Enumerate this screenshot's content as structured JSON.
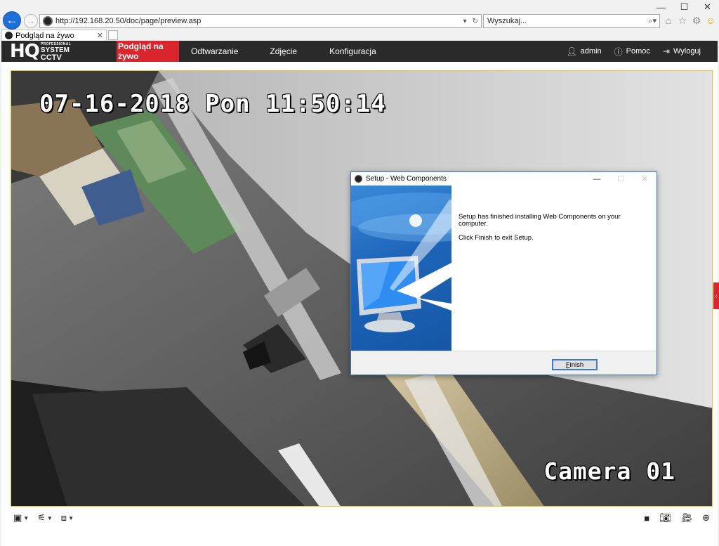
{
  "window": {
    "controls": [
      "—",
      "☐",
      "✕"
    ]
  },
  "browser": {
    "url": "http://192.168.20.50/doc/page/preview.asp",
    "search_placeholder": "Wyszukaj...",
    "tab_title": "Podgląd na żywo"
  },
  "app": {
    "logo_main": "HQ",
    "logo_line1": "PROFESSIONAL",
    "logo_line2": "SYSTEM",
    "logo_line3": "CCTV",
    "nav": [
      {
        "label": "Podgląd na żywo",
        "active": true
      },
      {
        "label": "Odtwarzanie",
        "active": false
      },
      {
        "label": "Zdjęcie",
        "active": false
      },
      {
        "label": "Konfiguracja",
        "active": false
      }
    ],
    "user": "admin",
    "help": "Pomoc",
    "logout": "Wyloguj"
  },
  "video": {
    "osd_datetime": "07-16-2018 Pon 11:50:14",
    "osd_camera": "Camera 01"
  },
  "dialog": {
    "title": "Setup - Web Components",
    "message_line1": "Setup has finished installing Web Components on your computer.",
    "message_line2": "Click Finish to exit Setup.",
    "finish_first_letter": "F",
    "finish_rest": "inish"
  },
  "colors": {
    "nav_active": "#d9262c",
    "header_bg": "#2a2a2a",
    "video_border": "#e6c13b",
    "dialog_accent": "#3b79c5"
  }
}
